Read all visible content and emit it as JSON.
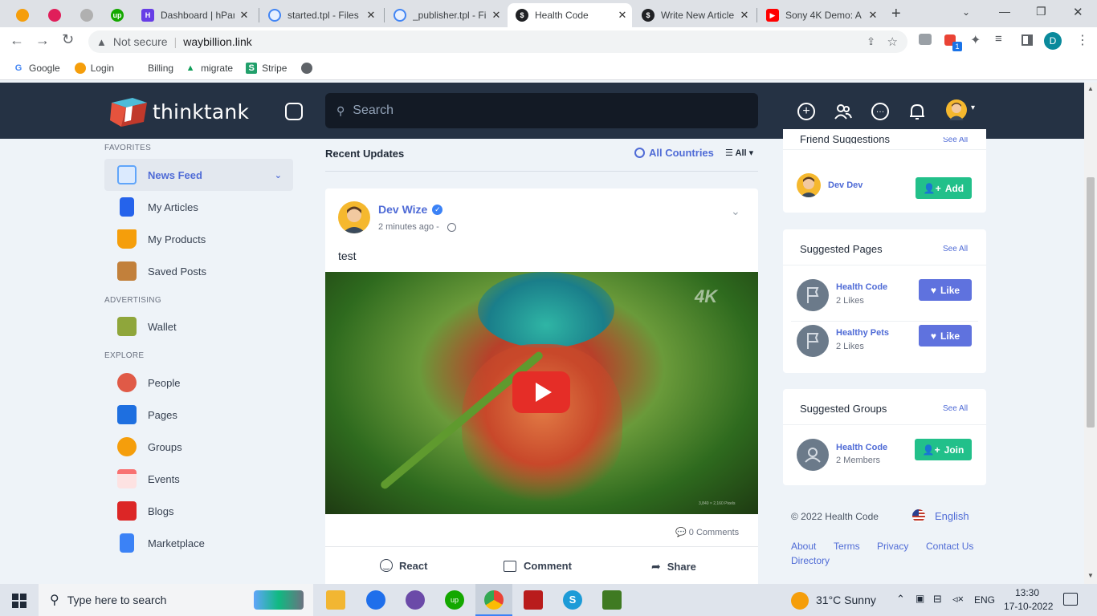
{
  "browser": {
    "tabs": [
      {
        "label": "",
        "icon": "orange-app-icon",
        "color": "#f59e0b"
      },
      {
        "label": "",
        "icon": "slack-icon",
        "color": "#e01e5a"
      },
      {
        "label": "",
        "icon": "wp-icon",
        "color": "#b0b0b0"
      },
      {
        "label": "",
        "icon": "upwork-icon",
        "color": "#14a800"
      },
      {
        "label": "Dashboard | hPan",
        "icon": "hpanel-icon",
        "color": "#673de6"
      },
      {
        "label": "started.tpl - Files",
        "icon": "file-icon",
        "color": "#4285f4"
      },
      {
        "label": "_publisher.tpl - Fi",
        "icon": "file-icon",
        "color": "#4285f4"
      },
      {
        "label": "Health Code",
        "icon": "dollar-icon",
        "color": "#202124"
      },
      {
        "label": "Write New Article",
        "icon": "dollar-icon",
        "color": "#202124"
      },
      {
        "label": "Sony 4K Demo: A",
        "icon": "youtube-icon",
        "color": "#ff0000"
      }
    ],
    "security": "Not secure",
    "url": "waybillion.link",
    "profile_initial": "D",
    "extension_badge": "1",
    "bookmarks": [
      {
        "label": "Google",
        "icon": "google-icon",
        "color": "#4285f4"
      },
      {
        "label": "Login",
        "icon": "orange-app-icon",
        "color": "#f59e0b"
      },
      {
        "label": "Billing",
        "icon": "blank-icon",
        "color": "#ffffff"
      },
      {
        "label": "migrate",
        "icon": "drive-icon",
        "color": "#0f9d58"
      },
      {
        "label": "Stripe",
        "icon": "stripe-icon",
        "color": "#22a06b"
      },
      {
        "label": "",
        "icon": "globe-icon",
        "color": "#5f6368"
      }
    ]
  },
  "app": {
    "logo_text": "thinktank",
    "search_placeholder": "Search"
  },
  "sidebar": {
    "favorites_label": "FAVORITES",
    "favorites": [
      {
        "label": "News Feed",
        "icon": "newsfeed-icon",
        "color": "#60a5fa"
      },
      {
        "label": "My Articles",
        "icon": "articles-icon",
        "color": "#2563eb"
      },
      {
        "label": "My Products",
        "icon": "products-icon",
        "color": "#f59e0b"
      },
      {
        "label": "Saved Posts",
        "icon": "saved-icon",
        "color": "#c2803b"
      }
    ],
    "advertising_label": "ADVERTISING",
    "advertising": [
      {
        "label": "Wallet",
        "icon": "wallet-icon",
        "color": "#6b8e23"
      }
    ],
    "explore_label": "EXPLORE",
    "explore": [
      {
        "label": "People",
        "icon": "people-icon",
        "color": "#e05a47"
      },
      {
        "label": "Pages",
        "icon": "pages-icon",
        "color": "#1e6fe0"
      },
      {
        "label": "Groups",
        "icon": "groups-icon",
        "color": "#f59e0b"
      },
      {
        "label": "Events",
        "icon": "events-icon",
        "color": "#f87171"
      },
      {
        "label": "Blogs",
        "icon": "blogs-icon",
        "color": "#dc2626"
      },
      {
        "label": "Marketplace",
        "icon": "marketplace-icon",
        "color": "#3b82f6"
      }
    ]
  },
  "feed": {
    "heading": "Recent Updates",
    "filter_countries": "All Countries",
    "filter_all": "All",
    "post": {
      "author": "Dev Wize",
      "time": "2 minutes ago -",
      "text": "test",
      "video_badge": "4K",
      "video_caption": "3,840 × 2,160 Pixels",
      "comments": "0 Comments",
      "actions": {
        "react": "React",
        "comment": "Comment",
        "share": "Share"
      }
    }
  },
  "right": {
    "friend_suggestions": {
      "title": "Friend Suggestions",
      "see_all": "See All",
      "items": [
        {
          "name": "Dev Dev",
          "button": "Add"
        }
      ]
    },
    "suggested_pages": {
      "title": "Suggested Pages",
      "see_all": "See All",
      "items": [
        {
          "name": "Health Code",
          "sub": "2 Likes",
          "button": "Like"
        },
        {
          "name": "Healthy Pets",
          "sub": "2 Likes",
          "button": "Like"
        }
      ]
    },
    "suggested_groups": {
      "title": "Suggested Groups",
      "see_all": "See All",
      "items": [
        {
          "name": "Health Code",
          "sub": "2 Members",
          "button": "Join"
        }
      ]
    },
    "footer": {
      "copyright": "© 2022 Health Code",
      "language": "English",
      "links": [
        "About",
        "Terms",
        "Privacy",
        "Contact Us",
        "Directory"
      ]
    }
  },
  "taskbar": {
    "search_placeholder": "Type here to search",
    "weather": "31°C  Sunny",
    "lang": "ENG",
    "time": "13:30",
    "date": "17-10-2022"
  },
  "colors": {
    "accent": "#4f6bd6",
    "green": "#22c08a",
    "navbar": "#253244"
  }
}
